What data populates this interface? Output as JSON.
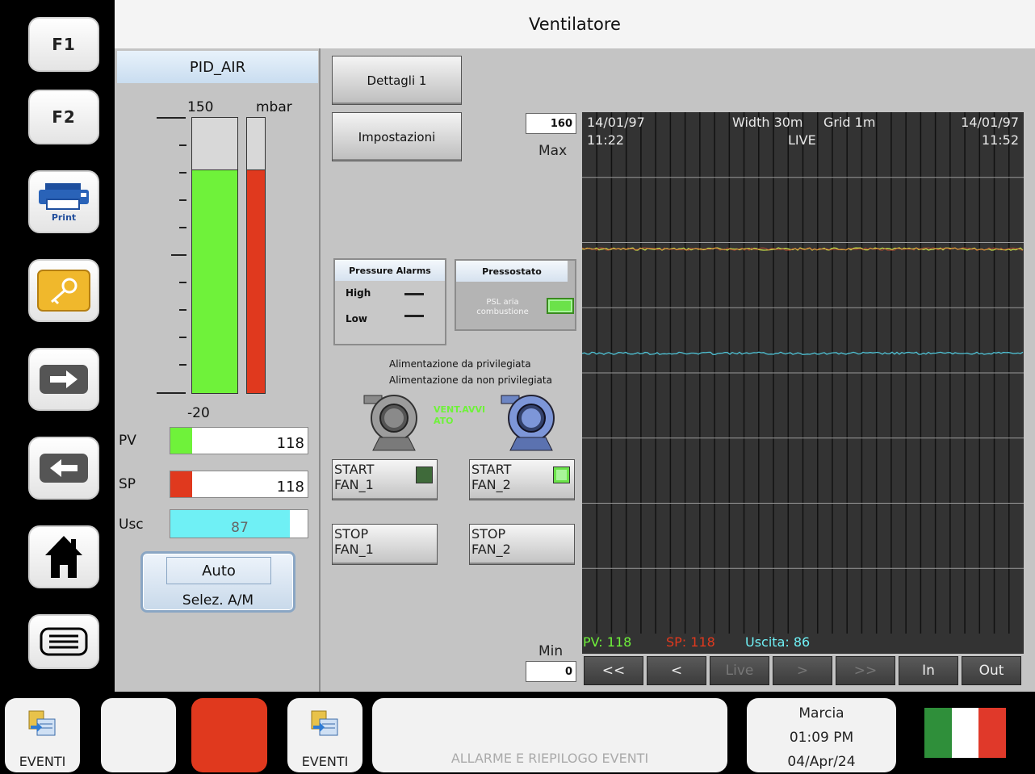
{
  "window": {
    "title": "Ventilatore"
  },
  "sidebar": {
    "f1_label": "F1",
    "f2_label": "F2",
    "print_label": "Print"
  },
  "pid": {
    "header": "PID_AIR",
    "scale_max": "150",
    "scale_min": "-20",
    "unit": "mbar",
    "pv_label": "PV",
    "pv_value": "118",
    "sp_label": "SP",
    "sp_value": "118",
    "usc_label": "Usc",
    "usc_value": "87",
    "pv_fill_fraction": 0.812,
    "sp_fill_fraction": 0.812,
    "usc_fill_fraction": 0.87,
    "mode_value": "Auto",
    "mode_button_label": "Selez. A/M",
    "colors": {
      "pv": "#6ff23a",
      "sp": "#e0391e",
      "usc": "#6ff0f5"
    }
  },
  "buttons": {
    "dettagli": "Dettagli 1",
    "impostazioni": "Impostazioni"
  },
  "pressure_alarms": {
    "title": "Pressure Alarms",
    "high_label": "High",
    "low_label": "Low"
  },
  "pressostato": {
    "title": "Pressostato",
    "psl_label_1": "PSL aria",
    "psl_label_2": "combustione"
  },
  "power": {
    "privileged": "Alimentazione da privilegiata",
    "non_privileged": "Alimentazione da non privilegiata"
  },
  "fans": {
    "status_line1": "VENT.AVVI",
    "status_line2": "ATO",
    "start1_line1": "START",
    "start1_line2": "FAN_1",
    "start2_line1": "START",
    "start2_line2": "FAN_2",
    "stop1_line1": "STOP",
    "stop1_line2": "FAN_1",
    "stop2_line1": "STOP",
    "stop2_line2": "FAN_2"
  },
  "chart_data": {
    "type": "line",
    "start_date": "14/01/97",
    "start_time": "11:22",
    "end_date": "14/01/97",
    "end_time": "11:52",
    "width_label": "Width 30m",
    "grid_label": "Grid 1m",
    "mode_label": "LIVE",
    "max_caption": "Max",
    "min_caption": "Min",
    "ylim": [
      0,
      160
    ],
    "ymax_text": "160",
    "ymin_text": "0",
    "grid": true,
    "series": [
      {
        "name": "PV",
        "value": 118,
        "color": "#c8e04a"
      },
      {
        "name": "SP",
        "value": 118,
        "color": "#e05030"
      },
      {
        "name": "Uscita",
        "value": 86,
        "color": "#4fc3d6"
      }
    ],
    "legend": {
      "pv": "PV: 118",
      "sp": "SP: 118",
      "usc": "Uscita: 86"
    }
  },
  "chart_nav": {
    "first": "<<",
    "prev": "<",
    "live": "Live",
    "next": ">",
    "last": ">>",
    "zoom_in": "In",
    "zoom_out": "Out"
  },
  "bottom": {
    "events1": "EVENTI",
    "events2": "EVENTI",
    "alarm_summary": "ALLARME E RIEPILOGO EVENTI",
    "status": "Marcia",
    "time": "01:09 PM",
    "date": "04/Apr/24"
  }
}
